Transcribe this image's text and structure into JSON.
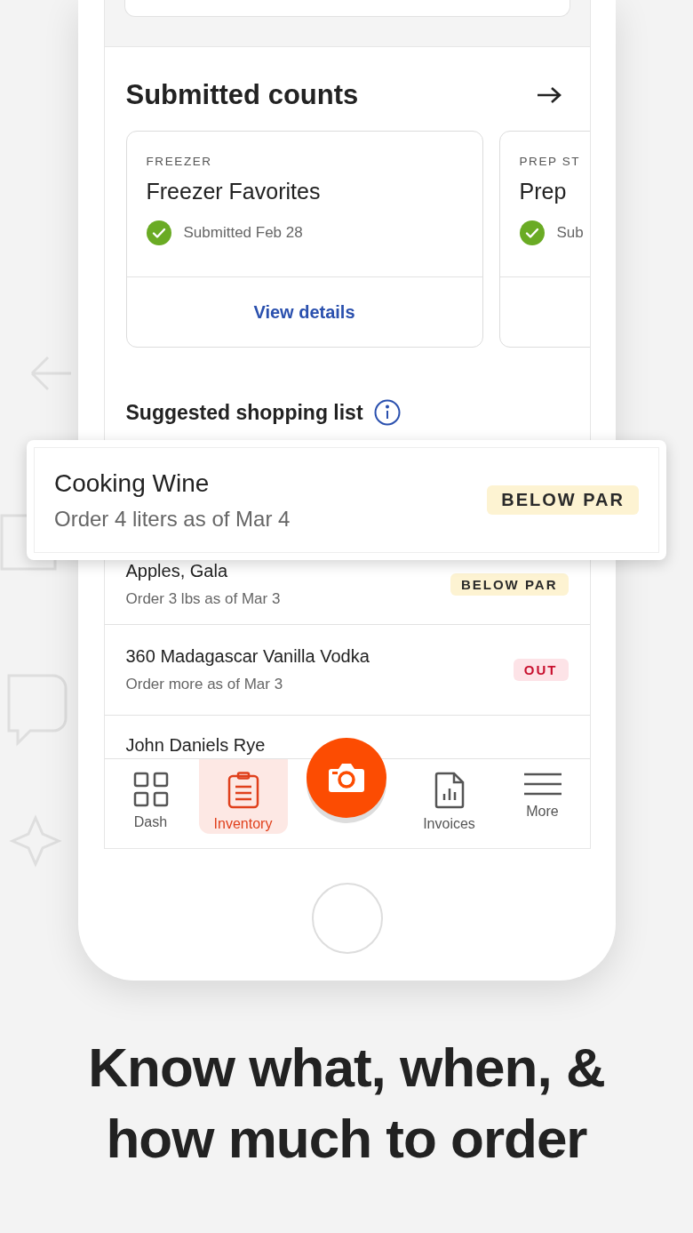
{
  "submitted_counts": {
    "title": "Submitted counts",
    "cards": [
      {
        "category": "FREEZER",
        "name": "Freezer Favorites",
        "status": "Submitted Feb 28",
        "submitted": true,
        "action": "View details"
      },
      {
        "category": "PREP ST",
        "name": "Prep",
        "status": "Sub",
        "submitted": true
      }
    ]
  },
  "shopping_list": {
    "title": "Suggested shopping list",
    "items": [
      {
        "name": "Apples, Gala",
        "detail": "Order 3 lbs as of Mar 3",
        "badge": "BELOW PAR",
        "kind": "below_par"
      },
      {
        "name": "360 Madagascar Vanilla Vodka",
        "detail": "Order more as of Mar 3",
        "badge": "OUT",
        "kind": "out"
      },
      {
        "name": "John Daniels Rye"
      }
    ]
  },
  "highlighted_item": {
    "name": "Cooking Wine",
    "detail": "Order 4 liters as of Mar 4",
    "badge": "BELOW PAR",
    "kind": "below_par"
  },
  "bottom_nav": {
    "items": [
      {
        "label": "Dash",
        "kind": "dash",
        "selected": false
      },
      {
        "label": "Inventory",
        "kind": "inventory",
        "selected": true
      },
      {
        "label": "Invoices",
        "kind": "invoices",
        "selected": false
      },
      {
        "label": "More",
        "kind": "more",
        "selected": false
      }
    ]
  },
  "headline": [
    "Know what, when, &",
    "how much to order"
  ]
}
